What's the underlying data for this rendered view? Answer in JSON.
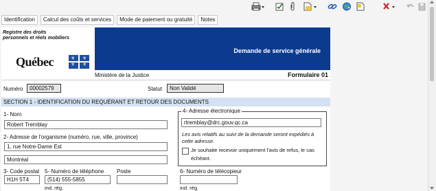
{
  "tabs": [
    "Identification",
    "Calcul des coûts et services",
    "Mode de paiement ou gratuité",
    "Notes"
  ],
  "toolbar_icons": [
    "printer-icon",
    "checklist-icon",
    "paperclip-icon",
    "new-document-icon",
    "link-icon",
    "globe-icon",
    "note-icon",
    "close-icon",
    "undo-icon",
    "save-icon"
  ],
  "header": {
    "registry_name": "Registre des droits personnels et réels mobiliers",
    "province": "Québec",
    "banner_title": "Demande de service générale",
    "ministry": "Ministère de la Justice",
    "form_number": "Formulaire 01"
  },
  "meta": {
    "numero_label": "Numéro",
    "numero_value": "00002579",
    "statut_label": "Statut",
    "statut_value": "Non Validé"
  },
  "section1": {
    "title": "SECTION 1 - IDENTIFICATION DU REQUÉRANT ET RETOUR DES DOCUMENTS",
    "nom_label": "1- Nom",
    "nom_value": "Robert Tremblay",
    "adresse_label": "2- Adresse de l'organisme (numéro, rue, ville, province)",
    "adresse_line1": "1, rue Notre-Dame Est",
    "adresse_line2": "Montréal",
    "code_postal_label": "3- Code postal",
    "code_postal_value": "H1H 5T4",
    "telephone_label": "5- Numéro de téléphone",
    "telephone_value": "(514) 555-5855",
    "poste_label": "Poste",
    "poste_value": "",
    "ind_reg_label": "ind. rég.",
    "email_label": "4- Adresse électronique",
    "email_value": "rtremblay@drc.gouv.qc.ca",
    "email_note": "Les avis relatifs au suivi de la demande seront expédiés à cette adresse.",
    "refusal_checkbox_label": "Je souhaite recevoir uniquement l'avis de refus, le cas échéant.",
    "refusal_checked": false,
    "fax_label": "6- Numéro de télécopieur",
    "fax_value": "",
    "fax_ind_reg_label": "ind. rég."
  }
}
